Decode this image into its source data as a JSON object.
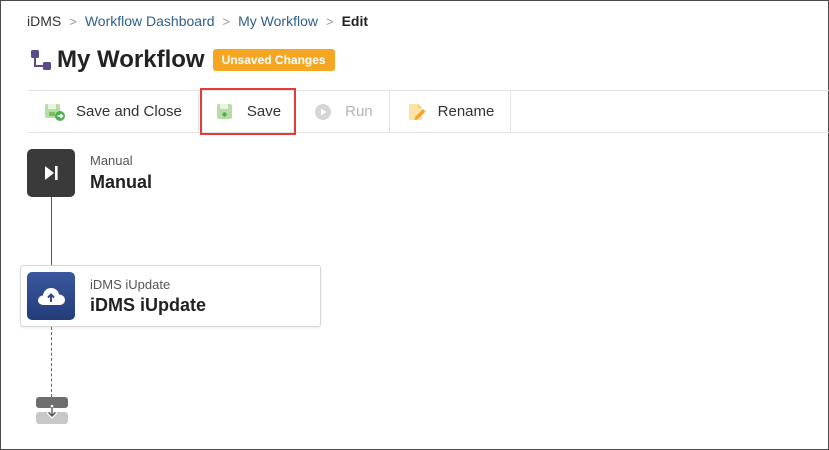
{
  "breadcrumb": {
    "items": [
      "iDMS",
      "Workflow Dashboard",
      "My Workflow",
      "Edit"
    ],
    "separator": ">"
  },
  "header": {
    "title": "My Workflow",
    "badge": "Unsaved Changes"
  },
  "toolbar": {
    "save_and_close": "Save and Close",
    "save": "Save",
    "run": "Run",
    "rename": "Rename"
  },
  "workflow": {
    "trigger": {
      "type": "Manual",
      "name": "Manual"
    },
    "steps": [
      {
        "type": "iDMS iUpdate",
        "name": "iDMS iUpdate"
      }
    ]
  },
  "colors": {
    "accent_link": "#2f5f8a",
    "badge": "#f5a623",
    "highlight": "#e03c3c",
    "trigger_icon_bg": "#3a3a3a",
    "iupdate_icon_bg": "#2e4a8c"
  }
}
